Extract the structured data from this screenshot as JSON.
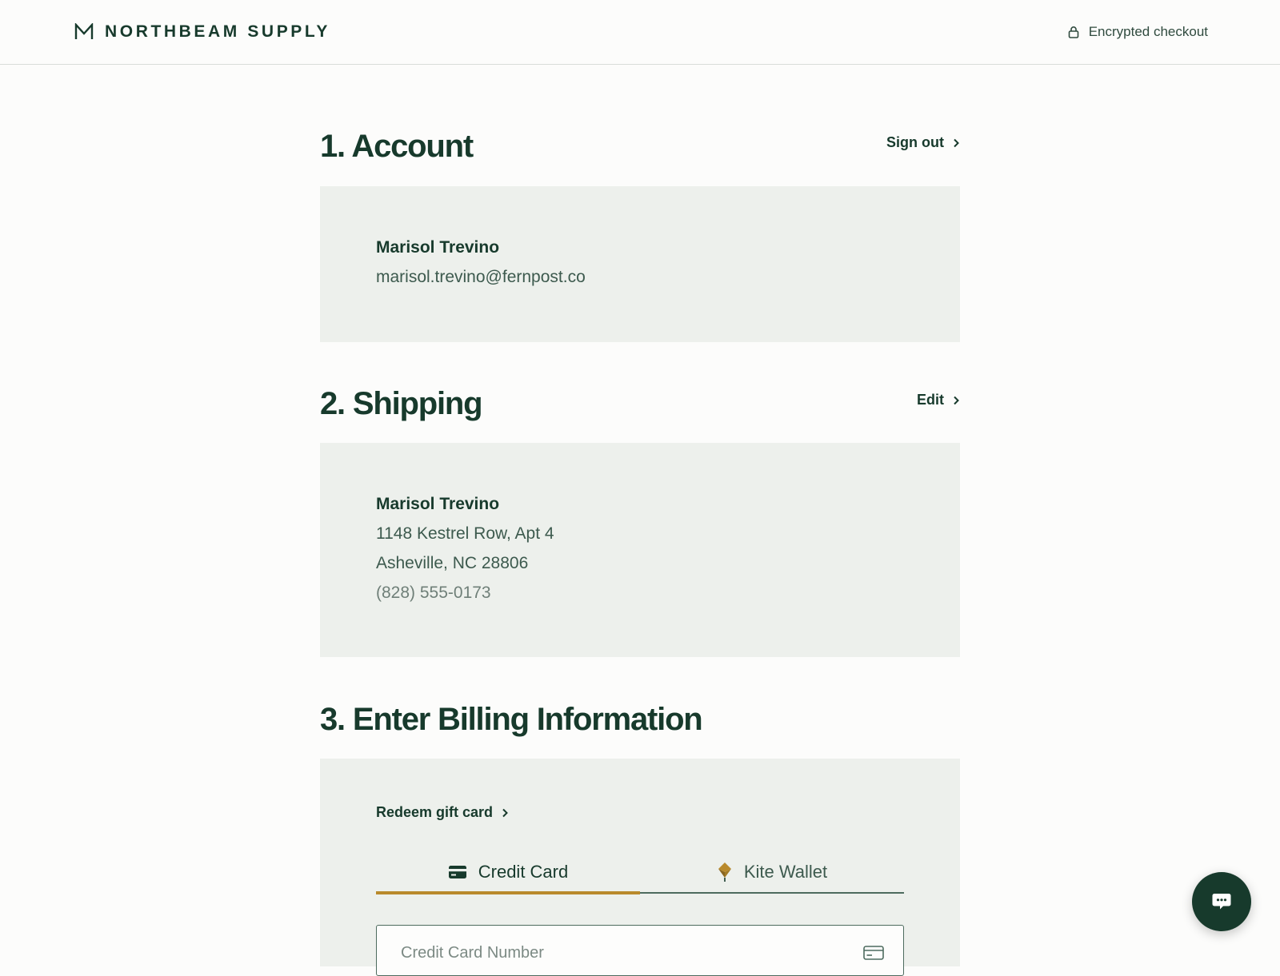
{
  "header": {
    "brand_name": "NORTHBEAM SUPPLY",
    "brand_icon": "northbeam-m-logo",
    "secure_icon": "lock-icon",
    "secure_label": "Encrypted checkout"
  },
  "account": {
    "title": "1. Account",
    "action_label": "Sign out",
    "name": "Marisol Trevino",
    "email": "marisol.trevino@fernpost.co"
  },
  "shipping": {
    "title": "2. Shipping",
    "action_label": "Edit",
    "name": "Marisol Trevino",
    "address_line1": "1148 Kestrel Row, Apt 4",
    "address_line2": "Asheville, NC 28806",
    "phone": "(828) 555-0173"
  },
  "billing": {
    "title": "3. Enter Billing Information",
    "gift_card_label": "Redeem gift card",
    "tabs": [
      {
        "label": "Credit Card",
        "icon": "credit-card-icon",
        "active": true
      },
      {
        "label": "Kite Wallet",
        "icon": "kite-icon",
        "active": false
      }
    ],
    "card_number_placeholder": "Credit Card Number",
    "card_number_value": ""
  },
  "chat": {
    "icon": "chat-bubble-icon"
  },
  "colors": {
    "primary": "#173a2c",
    "accent": "#b98a2c",
    "panel": "#edf0ec",
    "background": "#fcfcfb"
  }
}
